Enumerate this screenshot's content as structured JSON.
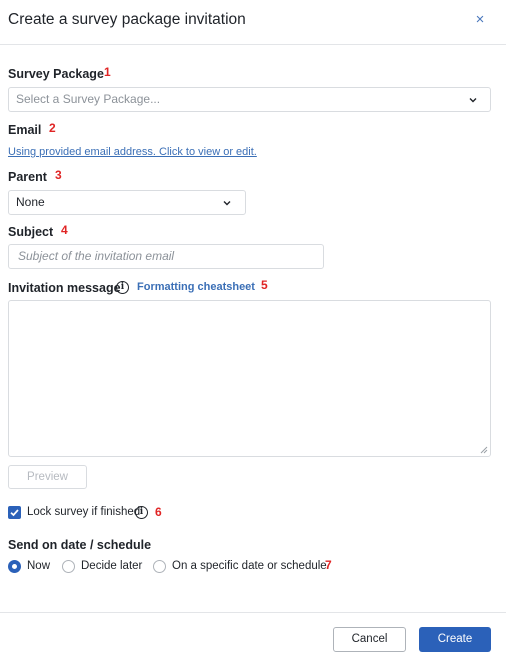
{
  "dialog": {
    "title": "Create a survey package invitation",
    "close_glyph": "×"
  },
  "survey_package": {
    "label": "Survey Package",
    "number": "1",
    "placeholder": "Select a Survey Package..."
  },
  "email": {
    "label": "Email",
    "number": "2",
    "link": "Using provided email address. Click to view or edit."
  },
  "parent": {
    "label": "Parent",
    "number": "3",
    "value": "None"
  },
  "subject": {
    "label": "Subject",
    "number": "4",
    "placeholder": "Subject of the invitation email"
  },
  "message": {
    "label": "Invitation message",
    "number": "5",
    "link": "Formatting cheatsheet",
    "value": ""
  },
  "preview_button": "Preview",
  "lock": {
    "label": "Lock survey if finished",
    "number": "6",
    "checked": true
  },
  "schedule": {
    "label": "Send on date / schedule",
    "number": "7",
    "options": [
      "Now",
      "Decide later",
      "On a specific date or schedule"
    ],
    "selected": "Now"
  },
  "footer": {
    "cancel": "Cancel",
    "create": "Create"
  },
  "icons": {
    "info": "i",
    "chevron": "chevron-down-icon",
    "check": "checkmark-icon"
  },
  "colors": {
    "accent": "#2b61b9",
    "link": "#3b6fb6",
    "annotation": "#e02424"
  }
}
